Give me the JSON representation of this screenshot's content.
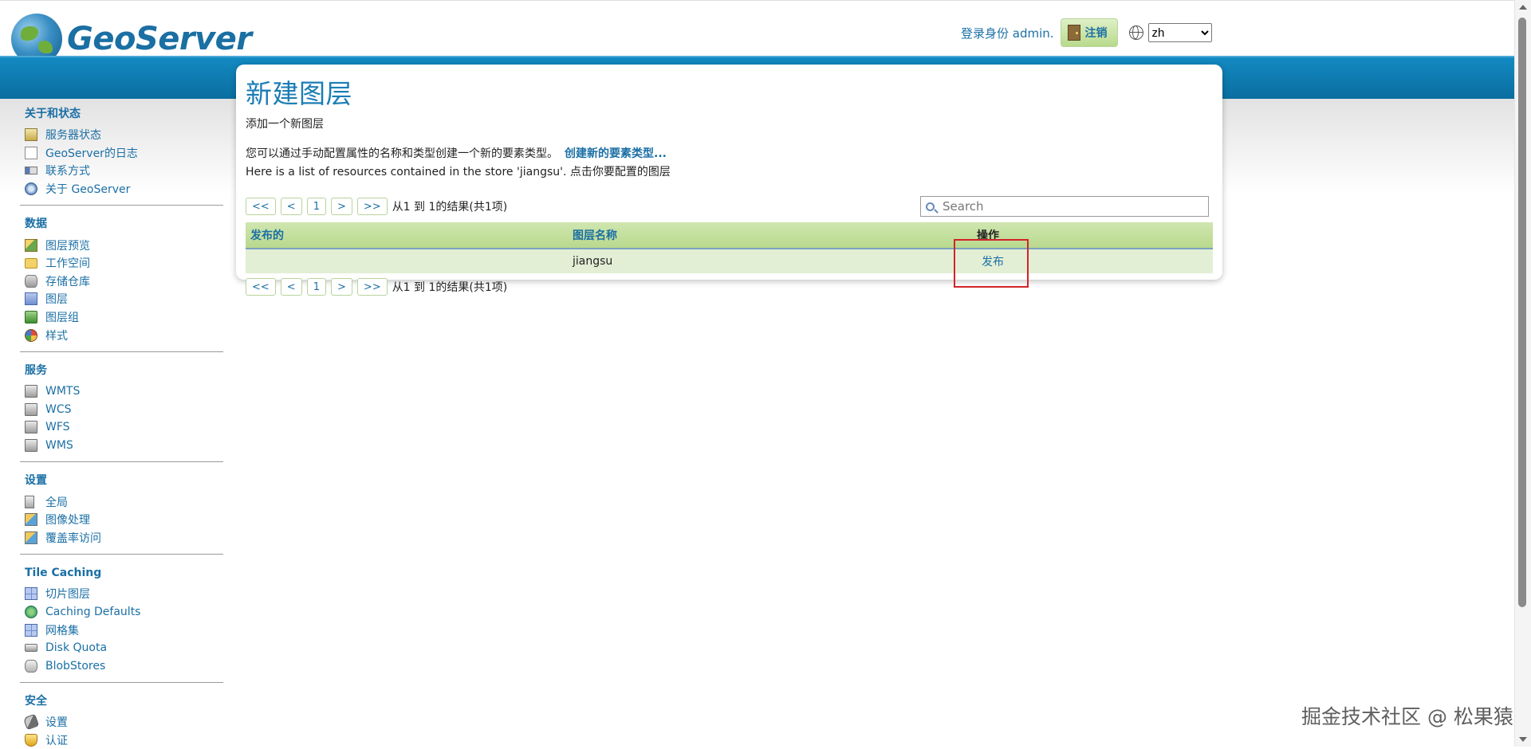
{
  "header": {
    "logo_text": "GeoServer",
    "login_text": "登录身份 admin.",
    "logout_label": "注销",
    "language": "zh"
  },
  "sidebar": {
    "sections": [
      {
        "title": "关于和状态",
        "items": [
          {
            "label": "服务器状态",
            "icon": "status-icon"
          },
          {
            "label": "GeoServer的日志",
            "icon": "document-icon"
          },
          {
            "label": "联系方式",
            "icon": "contact-icon"
          },
          {
            "label": "关于 GeoServer",
            "icon": "about-icon"
          }
        ]
      },
      {
        "title": "数据",
        "items": [
          {
            "label": "图层预览",
            "icon": "layer-preview-icon"
          },
          {
            "label": "工作空间",
            "icon": "folder-icon"
          },
          {
            "label": "存储仓库",
            "icon": "store-icon"
          },
          {
            "label": "图层",
            "icon": "layer-icon"
          },
          {
            "label": "图层组",
            "icon": "layer-group-icon"
          },
          {
            "label": "样式",
            "icon": "style-icon"
          }
        ]
      },
      {
        "title": "服务",
        "items": [
          {
            "label": "WMTS",
            "icon": "service-icon"
          },
          {
            "label": "WCS",
            "icon": "service-icon"
          },
          {
            "label": "WFS",
            "icon": "service-icon"
          },
          {
            "label": "WMS",
            "icon": "service-icon"
          }
        ]
      },
      {
        "title": "设置",
        "items": [
          {
            "label": "全局",
            "icon": "global-settings-icon"
          },
          {
            "label": "图像处理",
            "icon": "image-processing-icon"
          },
          {
            "label": "覆盖率访问",
            "icon": "coverage-access-icon"
          }
        ]
      },
      {
        "title": "Tile Caching",
        "items": [
          {
            "label": "切片图层",
            "icon": "tile-layers-icon"
          },
          {
            "label": "Caching Defaults",
            "icon": "caching-defaults-icon"
          },
          {
            "label": "网格集",
            "icon": "gridsets-icon"
          },
          {
            "label": "Disk Quota",
            "icon": "disk-quota-icon"
          },
          {
            "label": "BlobStores",
            "icon": "blobstores-icon"
          }
        ]
      },
      {
        "title": "安全",
        "items": [
          {
            "label": "设置",
            "icon": "security-settings-icon"
          },
          {
            "label": "认证",
            "icon": "authentication-icon"
          }
        ]
      }
    ]
  },
  "main": {
    "title": "新建图层",
    "subtitle": "添加一个新图层",
    "create_text": "您可以通过手动配置属性的名称和类型创建一个新的要素类型。",
    "create_link": "创建新的要素类型...",
    "list_text": "Here is a list of resources contained in the store 'jiangsu'. 点击你要配置的图层",
    "pager": {
      "first": "<<",
      "prev": "<",
      "page": "1",
      "next": ">",
      "last": ">>",
      "info": "从1 到 1的结果(共1项)"
    },
    "search": {
      "placeholder": "Search"
    },
    "table": {
      "headers": [
        "发布的",
        "图层名称",
        "操作"
      ],
      "rows": [
        {
          "published": "",
          "name": "jiangsu",
          "action": "发布"
        }
      ]
    }
  },
  "watermark": "掘金技术社区 @ 松果猿",
  "colors": {
    "accent": "#1b6fa5",
    "band": "#0a6c9e",
    "table_header": "#b9d98d",
    "row": "#e3efd5",
    "highlight": "#d2232a"
  }
}
